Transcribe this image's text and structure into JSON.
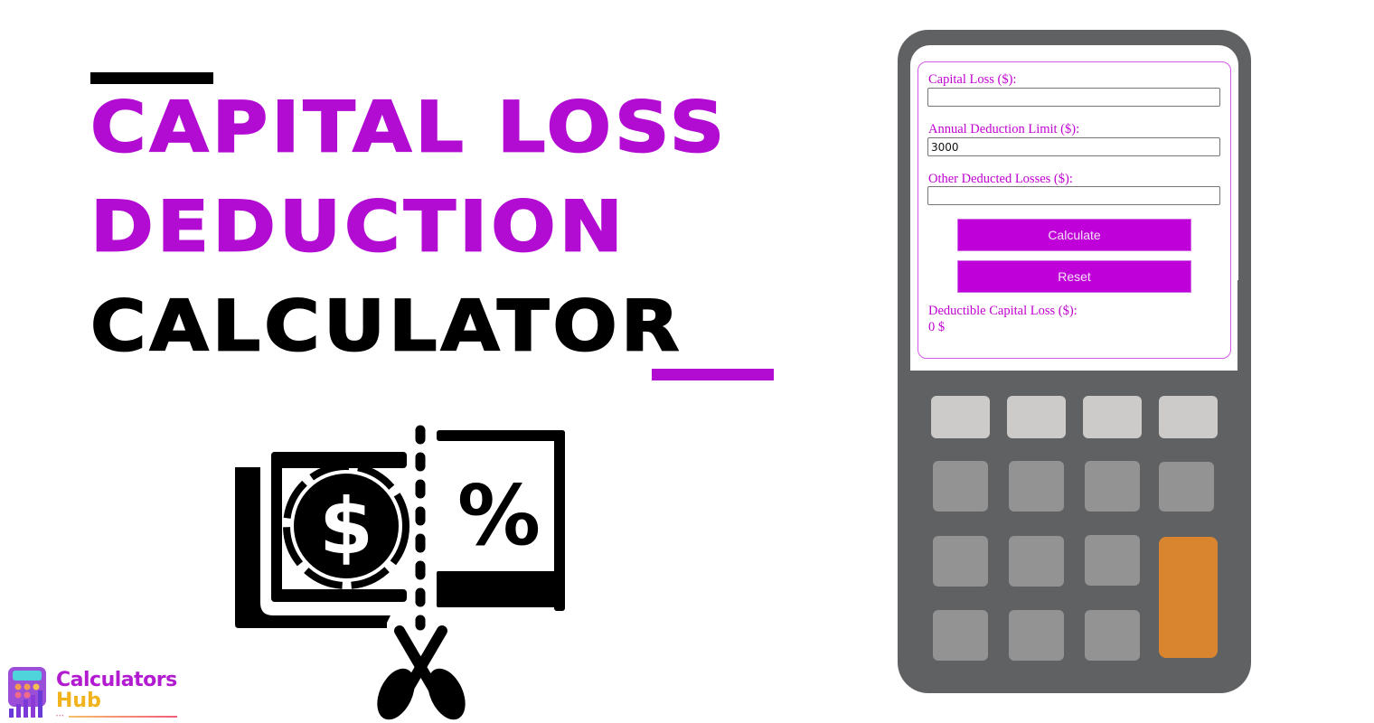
{
  "banner": {
    "title_lines": [
      "Capital Loss",
      "Deduction",
      "Calculator"
    ],
    "colors": {
      "accent": "#b20cd2",
      "dark": "#000000"
    }
  },
  "illustration": {
    "icons": [
      "money-bill-icon",
      "dollar-coin-icon",
      "percent-icon",
      "dashed-cut-line-icon",
      "scissors-icon"
    ],
    "glyphs": {
      "dollar": "$",
      "percent": "%"
    }
  },
  "logo": {
    "line1": "Calculators",
    "line2": "Hub",
    "dots": "•••"
  },
  "calculator": {
    "fields": [
      {
        "label": "Capital Loss ($):",
        "value": "",
        "placeholder": ""
      },
      {
        "label": "Annual Deduction Limit ($):",
        "value": "3000",
        "placeholder": ""
      },
      {
        "label": "Other Deducted Losses ($):",
        "value": "",
        "placeholder": ""
      }
    ],
    "buttons": {
      "calculate": "Calculate",
      "reset": "Reset"
    },
    "result": {
      "label": "Deductible Capital Loss ($):",
      "value": "0 $"
    },
    "colors": {
      "label": "#c000d0",
      "button": "#c000d8",
      "device_body": "#606163",
      "key_light": "#cccbc9",
      "key_mid": "#939393",
      "key_equals": "#d98530"
    }
  }
}
